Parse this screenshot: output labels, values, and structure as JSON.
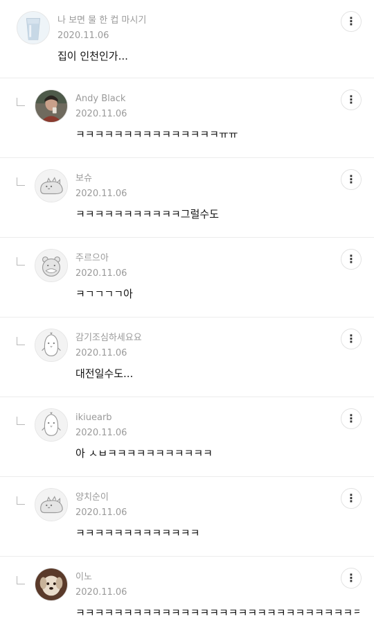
{
  "more_icon": "more-vertical-icon",
  "comments": [
    {
      "author": "나 보면 물 한 컵 마시기",
      "date": "2020.11.06",
      "text": "집이 인천인가...",
      "avatar": "glass-of-water-photo"
    },
    {
      "author": "Andy Black",
      "date": "2020.11.06",
      "text": "ㅋㅋㅋㅋㅋㅋㅋㅋㅋㅋㅋㅋㅋㅋㅋㅠㅠ",
      "avatar": "person-photo"
    },
    {
      "author": "보슈",
      "date": "2020.11.06",
      "text": "ㅋㅋㅋㅋㅋㅋㅋㅋㅋㅋㅋ그럴수도",
      "avatar": "default-creature-avatar"
    },
    {
      "author": "주르으아",
      "date": "2020.11.06",
      "text": "ㅋㄱㄱㄱㄱ아",
      "avatar": "default-bear-avatar"
    },
    {
      "author": "감기조심하세요요",
      "date": "2020.11.06",
      "text": "대전일수도...",
      "avatar": "default-penguin-avatar"
    },
    {
      "author": "ikiuearb",
      "date": "2020.11.06",
      "text": "아 ㅅㅂㅋㅋㅋㅋㅋㅋㅋㅋㅋㅋㅋ",
      "avatar": "default-penguin-avatar"
    },
    {
      "author": "양치순이",
      "date": "2020.11.06",
      "text": "ㅋㅋㅋㅋㅋㅋㅋㅋㅋㅋㅋㅋㅋ",
      "avatar": "default-creature-avatar"
    },
    {
      "author": "이노",
      "date": "2020.11.06",
      "text": "ㅋㅋㅋㅋㅋㅋㅋㅋㅋㅋㅋㅋㅋㅋㅋㅋㅋㅋㅋㅋㅋㅋㅋㅋㅋㅋㅋㅋㅋㅋㅋㅋㅋ",
      "avatar": "dog-photo"
    }
  ]
}
